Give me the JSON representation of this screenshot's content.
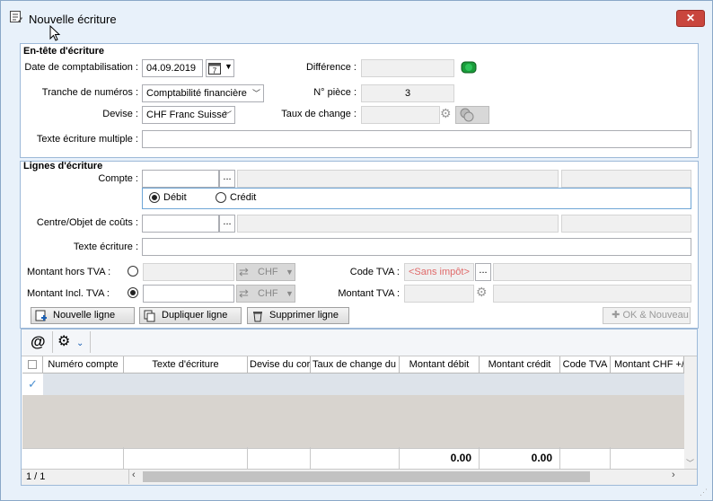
{
  "window": {
    "title": "Nouvelle écriture",
    "close_label": "✕"
  },
  "header": {
    "section_title": "En-tête d'écriture",
    "date_label": "Date de comptabilisation :",
    "date_value": "04.09.2019",
    "calendar_label": "7",
    "difference_label": "Différence :",
    "difference_value": "",
    "range_label": "Tranche de numéros :",
    "range_value": "Comptabilité financière",
    "piece_label": "N° pièce :",
    "piece_value": "3",
    "currency_label": "Devise :",
    "currency_value": "CHF Franc Suisse",
    "rate_label": "Taux de change :",
    "rate_value": "",
    "multi_text_label": "Texte écriture multiple :",
    "multi_text_value": "",
    "status_color": "#1a9b3a"
  },
  "lines": {
    "section_title": "Lignes d'écriture",
    "account_label": "Compte :",
    "account_value": "",
    "ellipsis": "...",
    "debit_label": "Débit",
    "credit_label": "Crédit",
    "cost_label": "Centre/Objet de coûts :",
    "cost_value": "",
    "text_label": "Texte écriture :",
    "text_value": "",
    "amount_excl_label": "Montant hors TVA :",
    "amount_incl_label": "Montant Incl. TVA :",
    "amount_incl_value": "",
    "chf_label": "CHF",
    "vat_code_label": "Code TVA :",
    "vat_code_value": "<Sans impôt>",
    "vat_amount_label": "Montant TVA :"
  },
  "buttons": {
    "new_line": "Nouvelle ligne",
    "duplicate_line": "Dupliquer ligne",
    "delete_line": "Supprimer ligne",
    "ok_new": "OK & Nouveau"
  },
  "toolbar": {
    "at_icon": "@",
    "settings_icon": "gear-icon"
  },
  "grid": {
    "columns": [
      "Numéro compte",
      "Texte d'écriture",
      "Devise du cor",
      "Taux de change du",
      "Montant débit",
      "Montant crédit",
      "Code TVA",
      "Montant CHF +/-"
    ],
    "totals": {
      "debit": "0.00",
      "credit": "0.00"
    },
    "pager": "1 / 1"
  }
}
